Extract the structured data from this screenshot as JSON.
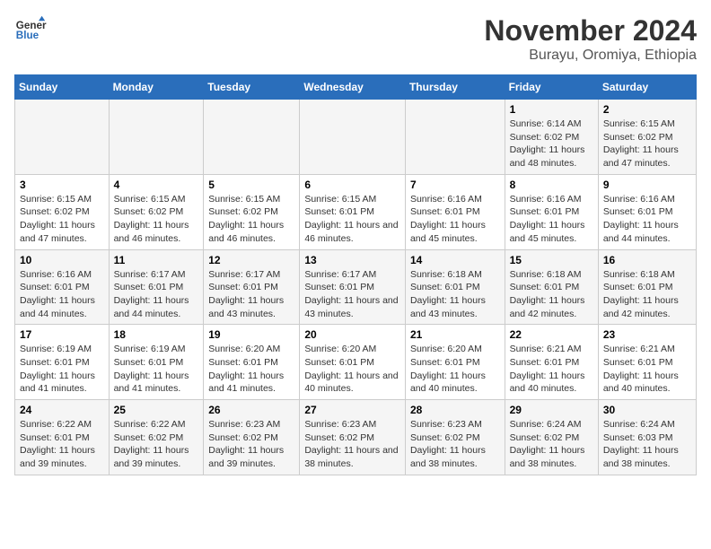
{
  "header": {
    "logo_line1": "General",
    "logo_line2": "Blue",
    "title": "November 2024",
    "subtitle": "Burayu, Oromiya, Ethiopia"
  },
  "weekdays": [
    "Sunday",
    "Monday",
    "Tuesday",
    "Wednesday",
    "Thursday",
    "Friday",
    "Saturday"
  ],
  "weeks": [
    [
      {
        "day": "",
        "info": ""
      },
      {
        "day": "",
        "info": ""
      },
      {
        "day": "",
        "info": ""
      },
      {
        "day": "",
        "info": ""
      },
      {
        "day": "",
        "info": ""
      },
      {
        "day": "1",
        "info": "Sunrise: 6:14 AM\nSunset: 6:02 PM\nDaylight: 11 hours and 48 minutes."
      },
      {
        "day": "2",
        "info": "Sunrise: 6:15 AM\nSunset: 6:02 PM\nDaylight: 11 hours and 47 minutes."
      }
    ],
    [
      {
        "day": "3",
        "info": "Sunrise: 6:15 AM\nSunset: 6:02 PM\nDaylight: 11 hours and 47 minutes."
      },
      {
        "day": "4",
        "info": "Sunrise: 6:15 AM\nSunset: 6:02 PM\nDaylight: 11 hours and 46 minutes."
      },
      {
        "day": "5",
        "info": "Sunrise: 6:15 AM\nSunset: 6:02 PM\nDaylight: 11 hours and 46 minutes."
      },
      {
        "day": "6",
        "info": "Sunrise: 6:15 AM\nSunset: 6:01 PM\nDaylight: 11 hours and 46 minutes."
      },
      {
        "day": "7",
        "info": "Sunrise: 6:16 AM\nSunset: 6:01 PM\nDaylight: 11 hours and 45 minutes."
      },
      {
        "day": "8",
        "info": "Sunrise: 6:16 AM\nSunset: 6:01 PM\nDaylight: 11 hours and 45 minutes."
      },
      {
        "day": "9",
        "info": "Sunrise: 6:16 AM\nSunset: 6:01 PM\nDaylight: 11 hours and 44 minutes."
      }
    ],
    [
      {
        "day": "10",
        "info": "Sunrise: 6:16 AM\nSunset: 6:01 PM\nDaylight: 11 hours and 44 minutes."
      },
      {
        "day": "11",
        "info": "Sunrise: 6:17 AM\nSunset: 6:01 PM\nDaylight: 11 hours and 44 minutes."
      },
      {
        "day": "12",
        "info": "Sunrise: 6:17 AM\nSunset: 6:01 PM\nDaylight: 11 hours and 43 minutes."
      },
      {
        "day": "13",
        "info": "Sunrise: 6:17 AM\nSunset: 6:01 PM\nDaylight: 11 hours and 43 minutes."
      },
      {
        "day": "14",
        "info": "Sunrise: 6:18 AM\nSunset: 6:01 PM\nDaylight: 11 hours and 43 minutes."
      },
      {
        "day": "15",
        "info": "Sunrise: 6:18 AM\nSunset: 6:01 PM\nDaylight: 11 hours and 42 minutes."
      },
      {
        "day": "16",
        "info": "Sunrise: 6:18 AM\nSunset: 6:01 PM\nDaylight: 11 hours and 42 minutes."
      }
    ],
    [
      {
        "day": "17",
        "info": "Sunrise: 6:19 AM\nSunset: 6:01 PM\nDaylight: 11 hours and 41 minutes."
      },
      {
        "day": "18",
        "info": "Sunrise: 6:19 AM\nSunset: 6:01 PM\nDaylight: 11 hours and 41 minutes."
      },
      {
        "day": "19",
        "info": "Sunrise: 6:20 AM\nSunset: 6:01 PM\nDaylight: 11 hours and 41 minutes."
      },
      {
        "day": "20",
        "info": "Sunrise: 6:20 AM\nSunset: 6:01 PM\nDaylight: 11 hours and 40 minutes."
      },
      {
        "day": "21",
        "info": "Sunrise: 6:20 AM\nSunset: 6:01 PM\nDaylight: 11 hours and 40 minutes."
      },
      {
        "day": "22",
        "info": "Sunrise: 6:21 AM\nSunset: 6:01 PM\nDaylight: 11 hours and 40 minutes."
      },
      {
        "day": "23",
        "info": "Sunrise: 6:21 AM\nSunset: 6:01 PM\nDaylight: 11 hours and 40 minutes."
      }
    ],
    [
      {
        "day": "24",
        "info": "Sunrise: 6:22 AM\nSunset: 6:01 PM\nDaylight: 11 hours and 39 minutes."
      },
      {
        "day": "25",
        "info": "Sunrise: 6:22 AM\nSunset: 6:02 PM\nDaylight: 11 hours and 39 minutes."
      },
      {
        "day": "26",
        "info": "Sunrise: 6:23 AM\nSunset: 6:02 PM\nDaylight: 11 hours and 39 minutes."
      },
      {
        "day": "27",
        "info": "Sunrise: 6:23 AM\nSunset: 6:02 PM\nDaylight: 11 hours and 38 minutes."
      },
      {
        "day": "28",
        "info": "Sunrise: 6:23 AM\nSunset: 6:02 PM\nDaylight: 11 hours and 38 minutes."
      },
      {
        "day": "29",
        "info": "Sunrise: 6:24 AM\nSunset: 6:02 PM\nDaylight: 11 hours and 38 minutes."
      },
      {
        "day": "30",
        "info": "Sunrise: 6:24 AM\nSunset: 6:03 PM\nDaylight: 11 hours and 38 minutes."
      }
    ]
  ]
}
